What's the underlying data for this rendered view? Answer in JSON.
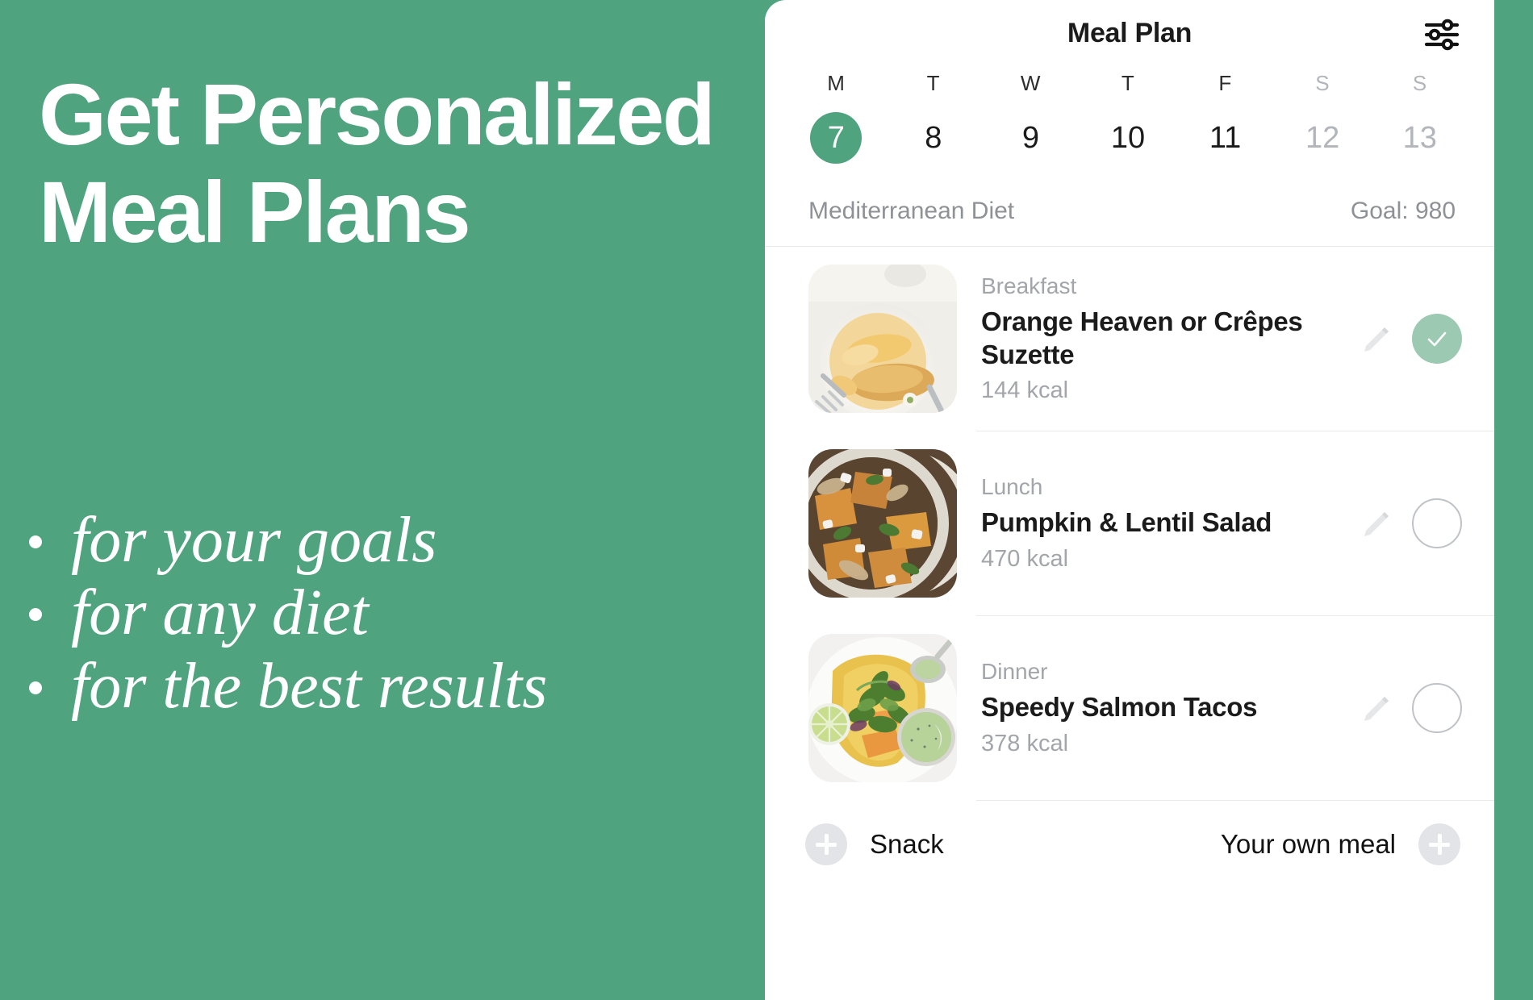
{
  "theme": {
    "brand_green": "#4FA37E",
    "muted_green": "#9CC9B1",
    "grey_text": "#A2A5AA",
    "divider": "#E9E9EA"
  },
  "promo": {
    "headline": "Get Personalized Meal Plans",
    "bullets": [
      {
        "text": "for your goals"
      },
      {
        "text": "for any diet"
      },
      {
        "text": "for the best results"
      }
    ]
  },
  "app": {
    "header": {
      "title": "Meal Plan",
      "filter_icon": "sliders-icon"
    },
    "week": [
      {
        "dow": "M",
        "num": "7",
        "selected": true,
        "weekend": false
      },
      {
        "dow": "T",
        "num": "8",
        "selected": false,
        "weekend": false
      },
      {
        "dow": "W",
        "num": "9",
        "selected": false,
        "weekend": false
      },
      {
        "dow": "T",
        "num": "10",
        "selected": false,
        "weekend": false
      },
      {
        "dow": "F",
        "num": "11",
        "selected": false,
        "weekend": false
      },
      {
        "dow": "S",
        "num": "12",
        "selected": false,
        "weekend": true
      },
      {
        "dow": "S",
        "num": "13",
        "selected": false,
        "weekend": true
      }
    ],
    "diet": {
      "name": "Mediterranean Diet",
      "goal": "Goal: 980"
    },
    "meals": [
      {
        "type": "Breakfast",
        "name": "Orange Heaven or Crêpes Suzette",
        "kcal": "144 kcal",
        "done": true,
        "thumb": "crepes-suzette-photo",
        "edit_icon": "pencil-icon",
        "status_icon": "check-icon"
      },
      {
        "type": "Lunch",
        "name": "Pumpkin & Lentil Salad",
        "kcal": "470 kcal",
        "done": false,
        "thumb": "pumpkin-lentil-salad-photo",
        "edit_icon": "pencil-icon",
        "status_icon": "empty-circle-icon"
      },
      {
        "type": "Dinner",
        "name": "Speedy Salmon Tacos",
        "kcal": "378 kcal",
        "done": false,
        "thumb": "salmon-tacos-photo",
        "edit_icon": "pencil-icon",
        "status_icon": "empty-circle-icon"
      }
    ],
    "bottom": {
      "snack_label": "Snack",
      "own_meal_label": "Your own meal",
      "plus_icon": "plus-icon"
    }
  }
}
